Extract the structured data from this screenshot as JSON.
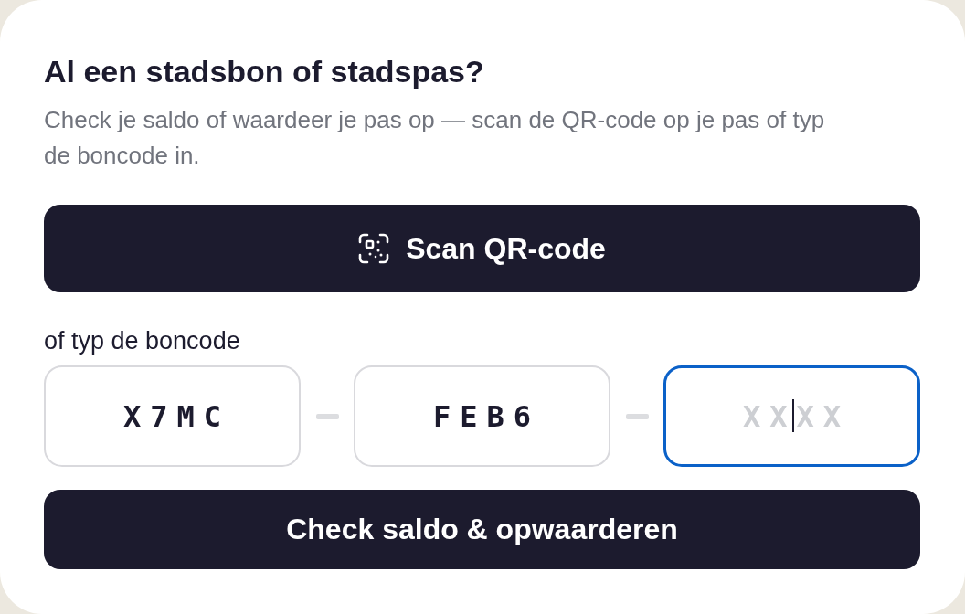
{
  "card": {
    "title": "Al een stadsbon of stadspas?",
    "description": "Check je saldo of waardeer je pas op — scan de QR-code op je pas of typ de boncode in.",
    "scan_button": {
      "label": "Scan QR-code"
    },
    "code_label": "of typ de boncode",
    "code_fields": [
      {
        "value": "X7MC",
        "focused": false
      },
      {
        "value": "FEB6",
        "focused": false
      },
      {
        "placeholder": "XXXX",
        "focused": true
      }
    ],
    "submit_button": {
      "label": "Check saldo & opwaarderen"
    }
  }
}
